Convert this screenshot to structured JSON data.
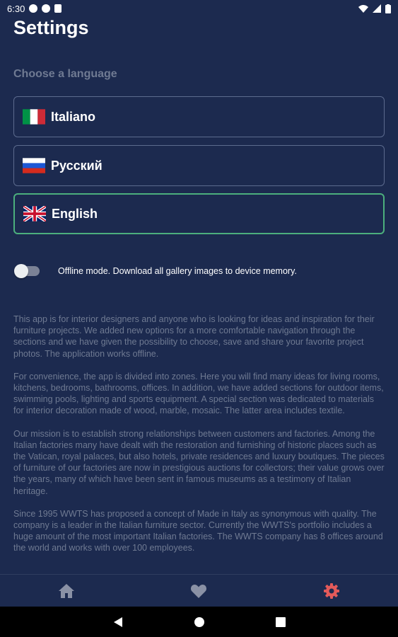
{
  "status_bar": {
    "time": "6:30"
  },
  "header": {
    "title": "Settings"
  },
  "language": {
    "section_label": "Choose a language",
    "options": [
      {
        "label": "Italiano",
        "flag": "italy-flag-icon"
      },
      {
        "label": "Русский",
        "flag": "russia-flag-icon"
      },
      {
        "label": "English",
        "flag": "uk-flag-icon",
        "selected": true
      }
    ]
  },
  "offline": {
    "label": "Offline mode. Download all gallery images to device memory.",
    "enabled": false
  },
  "about": {
    "paragraphs": [
      "This app is for interior designers and anyone who is looking for ideas and inspiration for their furniture projects. We added new options for a more comfortable navigation through the sections and we have given the possibility to choose, save and share your favorite project photos. The application works offline.",
      "For convenience, the app is divided into zones. Here you will find many ideas for living rooms, kitchens, bedrooms, bathrooms, offices. In addition, we have added sections for outdoor items, swimming pools, lighting and sports equipment. A special section was dedicated to materials for interior decoration made of wood, marble, mosaic. The latter area includes textile.",
      "Our mission is to establish strong relationships between customers and factories. Among the Italian factories many have dealt with the restoration and furnishing of historic places such as the Vatican, royal palaces, but also hotels, private residences and luxury boutiques. The pieces of furniture of our factories are now in prestigious auctions for collectors; their value grows over the years, many of which have been sent in famous museums as a testimony of Italian heritage.",
      "Since 1995 WWTS has proposed a concept of Made in Italy as synonymous with quality. The company is a leader in the Italian furniture sector. Currently the WWTS's portfolio includes a huge amount of the most important Italian factories. The WWTS company has 8 offices around the world and works with over 100 employees."
    ]
  },
  "bottom_nav": {
    "items": [
      {
        "icon": "home-icon",
        "active": false
      },
      {
        "icon": "heart-icon",
        "active": false
      },
      {
        "icon": "gear-icon",
        "active": true
      }
    ]
  },
  "colors": {
    "background": "#1c2a4f",
    "muted_text": "#6f7a92",
    "selected_border": "#4caf7d",
    "active_nav": "#e35a5a",
    "inactive_nav": "#8a91a5"
  }
}
